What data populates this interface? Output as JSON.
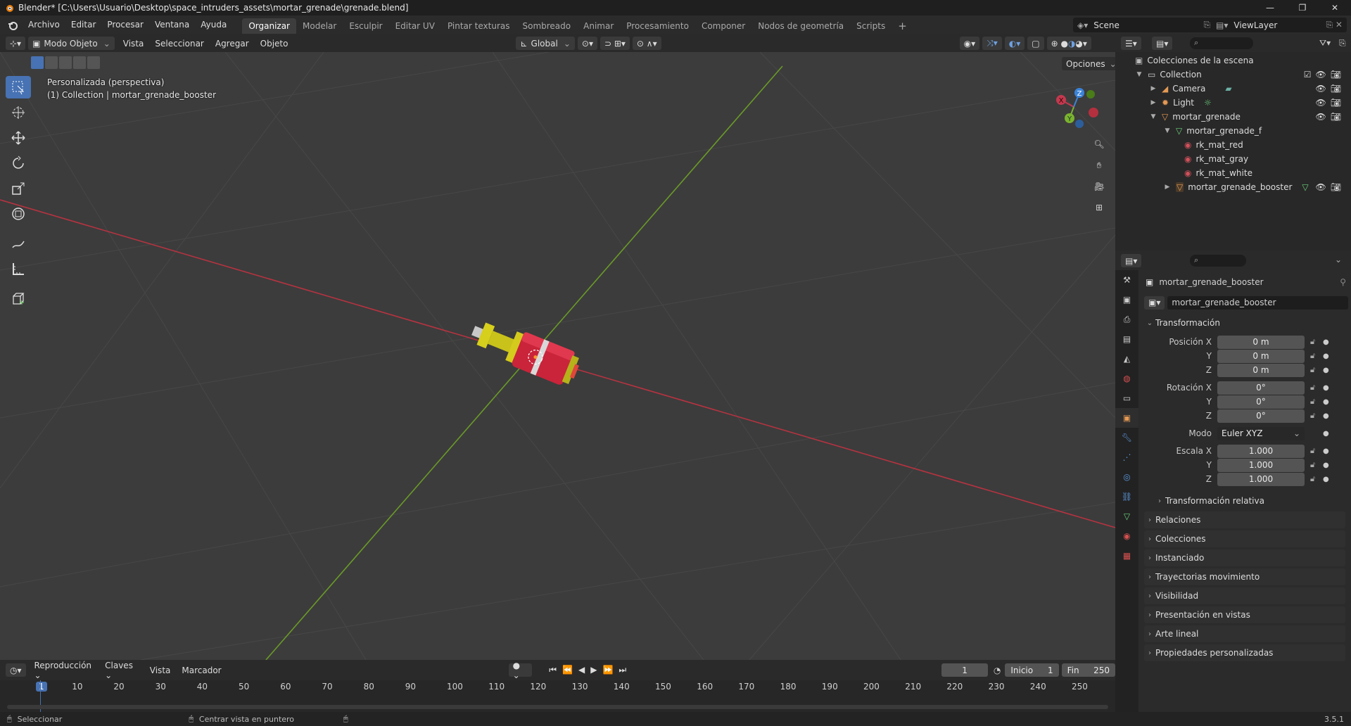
{
  "window": {
    "title": "Blender* [C:\\Users\\Usuario\\Desktop\\space_intruders_assets\\mortar_grenade\\grenade.blend]",
    "controls": [
      "—",
      "❐",
      "✕"
    ]
  },
  "menu": [
    "Archivo",
    "Editar",
    "Procesar",
    "Ventana",
    "Ayuda"
  ],
  "workspaces": [
    "Organizar",
    "Modelar",
    "Esculpir",
    "Editar UV",
    "Pintar texturas",
    "Sombreado",
    "Animar",
    "Procesamiento",
    "Componer",
    "Nodos de geometría",
    "Scripts"
  ],
  "active_workspace": "Organizar",
  "scene": "Scene",
  "view_layer": "ViewLayer",
  "viewport_header": {
    "mode": "Modo Objeto",
    "menus": [
      "Vista",
      "Seleccionar",
      "Agregar",
      "Objeto"
    ],
    "orientation": "Global",
    "options": "Opciones"
  },
  "viewport": {
    "view_name": "Personalizada (perspectiva)",
    "collection_info": "(1) Collection | mortar_grenade_booster",
    "axis_labels": {
      "x": "X",
      "y": "Y",
      "z": "Z"
    }
  },
  "outliner": {
    "root": "Colecciones de la escena",
    "items": [
      {
        "label": "Collection",
        "level": 0
      },
      {
        "label": "Camera",
        "level": 1
      },
      {
        "label": "Light",
        "level": 1
      },
      {
        "label": "mortar_grenade",
        "level": 1
      },
      {
        "label": "mortar_grenade_f",
        "level": 2
      },
      {
        "label": "rk_mat_red",
        "level": 3
      },
      {
        "label": "rk_mat_gray",
        "level": 3
      },
      {
        "label": "rk_mat_white",
        "level": 3
      },
      {
        "label": "mortar_grenade_booster",
        "level": 2
      }
    ]
  },
  "properties": {
    "object_name": "mortar_grenade_booster",
    "name_field": "mortar_grenade_booster",
    "transform_title": "Transformación",
    "position": {
      "label": "Posición X",
      "x": "0 m",
      "y": "0 m",
      "z": "0 m"
    },
    "rotation": {
      "label": "Rotación X",
      "x": "0°",
      "y": "0°",
      "z": "0°"
    },
    "mode": {
      "label": "Modo",
      "value": "Euler XYZ"
    },
    "scale": {
      "label": "Escala X",
      "x": "1.000",
      "y": "1.000",
      "z": "1.000"
    },
    "axis_y": "Y",
    "axis_z": "Z",
    "sub_relative": "Transformación relativa",
    "sections": [
      "Relaciones",
      "Colecciones",
      "Instanciado",
      "Trayectorias movimiento",
      "Visibilidad",
      "Presentación en vistas",
      "Arte lineal",
      "Propiedades personalizadas"
    ]
  },
  "timeline": {
    "menus": [
      "Reproducción",
      "Claves",
      "Vista",
      "Marcador"
    ],
    "current_frame": "1",
    "start_label": "Inicio",
    "start": "1",
    "end_label": "Fin",
    "end": "250",
    "ticks": [
      "1",
      "10",
      "20",
      "30",
      "40",
      "50",
      "60",
      "70",
      "80",
      "90",
      "100",
      "110",
      "120",
      "130",
      "140",
      "150",
      "160",
      "170",
      "180",
      "190",
      "200",
      "210",
      "220",
      "230",
      "240",
      "250"
    ]
  },
  "status": {
    "left": "Seleccionar",
    "middle": "Centrar vista en puntero",
    "version": "3.5.1"
  }
}
